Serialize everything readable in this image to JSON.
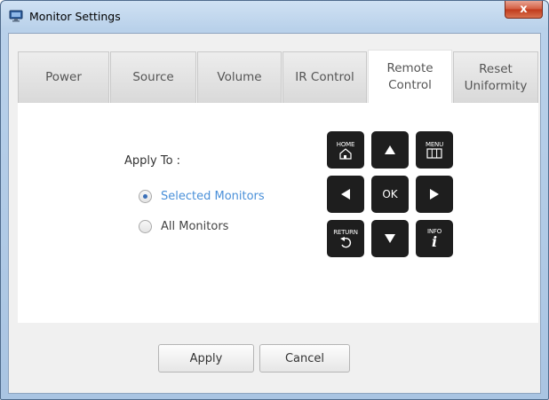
{
  "window": {
    "title": "Monitor Settings",
    "close_label": "x"
  },
  "tabs": [
    {
      "label": "Power"
    },
    {
      "label": "Source"
    },
    {
      "label": "Volume"
    },
    {
      "label": "IR Control"
    },
    {
      "label": "Remote\nControl",
      "active": true
    },
    {
      "label": "Reset\nUniformity"
    }
  ],
  "panel": {
    "apply_to_label": "Apply To :",
    "options": [
      {
        "label": "Selected Monitors",
        "checked": true
      },
      {
        "label": "All Monitors",
        "checked": false
      }
    ]
  },
  "remote": {
    "home_label": "HOME",
    "menu_label": "MENU",
    "ok_label": "OK",
    "return_label": "RETURN",
    "info_label": "INFO",
    "info_glyph": "i"
  },
  "buttons": {
    "apply_label": "Apply",
    "cancel_label": "Cancel"
  },
  "colors": {
    "accent": "#4a90d9",
    "key_bg": "#1e1e1e",
    "close_red": "#c0391b"
  }
}
